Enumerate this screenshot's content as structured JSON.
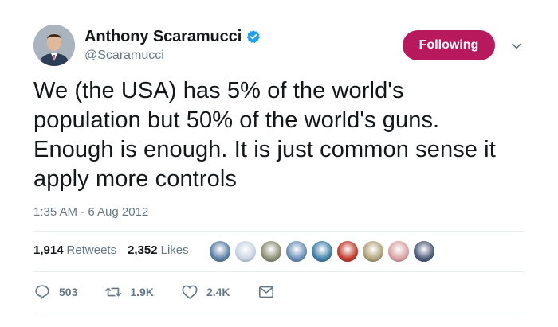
{
  "author": {
    "display_name": "Anthony Scaramucci",
    "handle": "@Scaramucci",
    "verified": true
  },
  "follow_button": {
    "label": "Following",
    "color": "#b7195c"
  },
  "tweet": {
    "text": "We (the USA) has 5% of the world's\npopulation but 50% of the world's guns.\nEnough is enough. It is just common sense it\napply more controls",
    "timestamp": "1:35 AM - 6 Aug 2012"
  },
  "stats": {
    "retweets_count": "1,914",
    "retweets_label": "Retweets",
    "likes_count": "2,352",
    "likes_label": "Likes"
  },
  "likers": [
    {
      "icon": "liker-avatar-1",
      "color": "#5b7fa6"
    },
    {
      "icon": "liker-avatar-2",
      "color": "#c8d4e3"
    },
    {
      "icon": "liker-avatar-3",
      "color": "#8a8f74"
    },
    {
      "icon": "liker-avatar-4",
      "color": "#6a8fb5"
    },
    {
      "icon": "liker-avatar-5",
      "color": "#3f7fa8"
    },
    {
      "icon": "liker-avatar-6",
      "color": "#c0392b"
    },
    {
      "icon": "liker-avatar-7",
      "color": "#b0a27a"
    },
    {
      "icon": "liker-avatar-8",
      "color": "#d9a0a0"
    },
    {
      "icon": "liker-avatar-9",
      "color": "#4a5a78"
    }
  ],
  "actions": {
    "reply_count": "503",
    "retweet_count": "1.9K",
    "like_count": "2.4K"
  },
  "colors": {
    "text_primary": "#14171a",
    "text_secondary": "#657786",
    "divider": "#e6ecf0",
    "verified_blue": "#1da1f2"
  }
}
